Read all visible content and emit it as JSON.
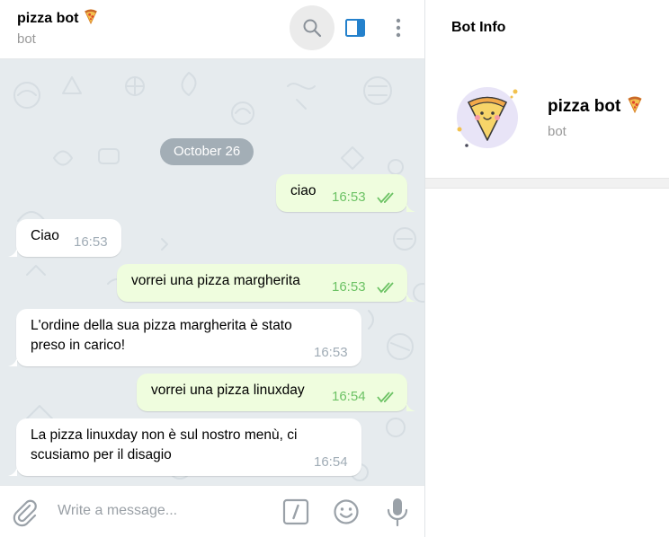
{
  "header": {
    "title": "pizza bot",
    "subtitle": "bot"
  },
  "date_pill": "October 26",
  "messages": [
    {
      "dir": "out",
      "text": "ciao",
      "time": "16:53",
      "read": true
    },
    {
      "dir": "in",
      "text": "Ciao",
      "time": "16:53"
    },
    {
      "dir": "out",
      "text": "vorrei una pizza margherita",
      "time": "16:53",
      "read": true
    },
    {
      "dir": "in",
      "lines": [
        "L'ordine della sua pizza margherita è stato",
        "preso in carico!"
      ],
      "time": "16:53"
    },
    {
      "dir": "out",
      "text": "vorrei una pizza linuxday",
      "time": "16:54",
      "read": true
    },
    {
      "dir": "in",
      "lines": [
        "La pizza linuxday non è sul nostro menù, ci",
        "scusiamo per il disagio"
      ],
      "time": "16:54"
    }
  ],
  "composer": {
    "placeholder": "Write a message..."
  },
  "info_panel": {
    "title": "Bot Info",
    "name": "pizza bot",
    "subtitle": "bot"
  },
  "colors": {
    "accent": "#2481cc",
    "outgoing_bubble": "#effdde",
    "read_ticks": "#6cc264",
    "chat_background": "#e6ebee"
  }
}
